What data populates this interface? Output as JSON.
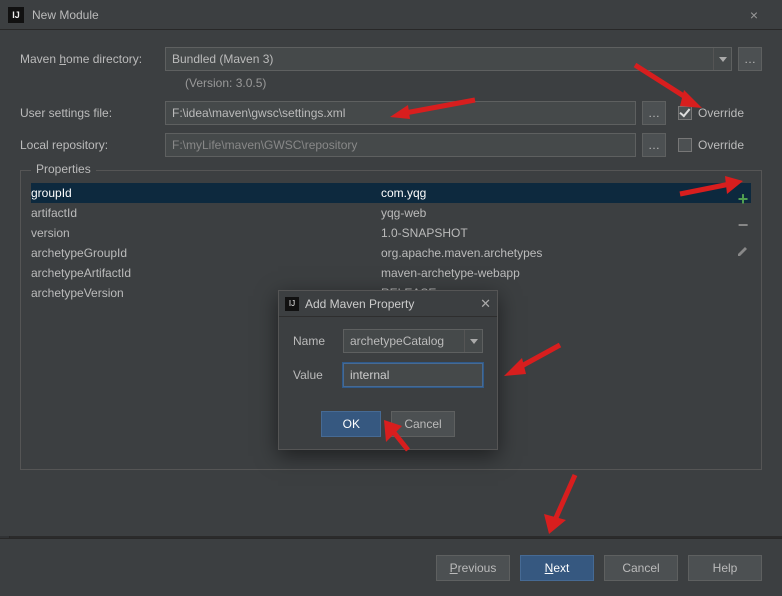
{
  "window": {
    "title": "New Module"
  },
  "labels": {
    "maven_home": "Maven home directory:",
    "user_settings": "User settings file:",
    "local_repo": "Local repository:",
    "override": "Override",
    "version_sub": "(Version: 3.0.5)",
    "properties": "Properties"
  },
  "fields": {
    "maven_home": "Bundled (Maven 3)",
    "user_settings": "F:\\idea\\maven\\gwsc\\settings.xml",
    "local_repo": "F:\\myLife\\maven\\GWSC\\repository"
  },
  "overrides": {
    "user_settings_checked": true,
    "local_repo_checked": false
  },
  "properties": [
    {
      "k": "groupId",
      "v": "com.yqg"
    },
    {
      "k": "artifactId",
      "v": "yqg-web"
    },
    {
      "k": "version",
      "v": "1.0-SNAPSHOT"
    },
    {
      "k": "archetypeGroupId",
      "v": "org.apache.maven.archetypes"
    },
    {
      "k": "archetypeArtifactId",
      "v": "maven-archetype-webapp"
    },
    {
      "k": "archetypeVersion",
      "v": "RELEASE"
    }
  ],
  "modal": {
    "title": "Add Maven Property",
    "name_label": "Name",
    "value_label": "Value",
    "name_value": "archetypeCatalog",
    "value_value": "internal",
    "ok": "OK",
    "cancel": "Cancel"
  },
  "footer": {
    "previous": "Previous",
    "next": "Next",
    "cancel": "Cancel",
    "help": "Help"
  }
}
